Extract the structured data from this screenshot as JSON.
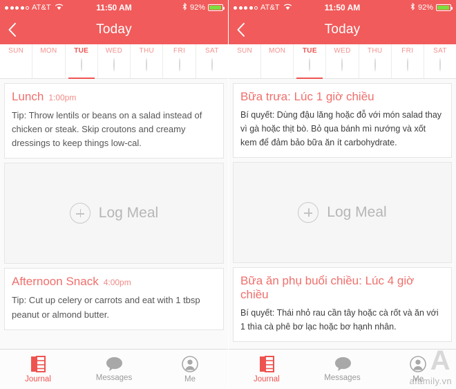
{
  "status_bar": {
    "carrier": "AT&T",
    "signal_dots_filled": 4,
    "signal_dots_total": 5,
    "wifi_icon": "wifi-icon",
    "time": "11:50 AM",
    "bluetooth_icon": "bluetooth-icon",
    "battery_percent": "92%",
    "battery_fill_ratio": 0.92
  },
  "nav": {
    "back_icon": "chevron-left-icon",
    "title_en": "Today",
    "title_vi": "Today"
  },
  "day_strip": {
    "days": [
      {
        "label": "SUN",
        "marker": "blob",
        "active": false
      },
      {
        "label": "MON",
        "marker": "blob",
        "active": false
      },
      {
        "label": "TUE",
        "marker": "circle",
        "active": true
      },
      {
        "label": "WED",
        "marker": "circle",
        "active": false
      },
      {
        "label": "THU",
        "marker": "circle",
        "active": false
      },
      {
        "label": "FRI",
        "marker": "circle",
        "active": false
      },
      {
        "label": "SAT",
        "marker": "circle",
        "active": false
      }
    ]
  },
  "left": {
    "lunch": {
      "title": "Lunch",
      "time": "1:00pm",
      "tip": "Tip: Throw lentils or beans on a salad instead of chicken or steak. Skip croutons and creamy dressings to keep things low-cal."
    },
    "log_meal_label": "Log Meal",
    "snack": {
      "title": "Afternoon Snack",
      "time": "4:00pm",
      "tip": "Tip: Cut up celery or carrots and eat with 1 tbsp peanut or almond butter."
    }
  },
  "right": {
    "lunch": {
      "title": "Bữa trưa: Lúc 1 giờ chiều",
      "tip": "Bí quyết: Dùng đậu lăng hoặc đỗ với món salad thay vì gà hoặc thịt bò. Bỏ qua bánh mì nướng và xốt kem để đảm bảo bữa ăn ít carbohydrate."
    },
    "log_meal_label": "Log Meal",
    "snack": {
      "title": "Bữa ăn phụ buổi chiều: Lúc 4 giờ chiều",
      "tip": "Bí quyết: Thái nhỏ rau cần tây hoặc cà rốt và ăn với 1 thìa cà phê bơ lạc hoặc bơ hạnh nhân."
    }
  },
  "tab_bar": {
    "tabs": [
      {
        "label": "Journal",
        "icon": "journal-icon",
        "active": true
      },
      {
        "label": "Messages",
        "icon": "message-bubble-icon",
        "active": false
      },
      {
        "label": "Me",
        "icon": "person-icon",
        "active": false
      }
    ]
  },
  "watermark": {
    "text": "afamily.vn",
    "mark": "A"
  },
  "colors": {
    "accent": "#f15b5b",
    "accent_text": "#ef6f6b",
    "tab_active": "#ef5350",
    "battery_green": "#7ddc3e",
    "content_bg": "#fafafa"
  }
}
